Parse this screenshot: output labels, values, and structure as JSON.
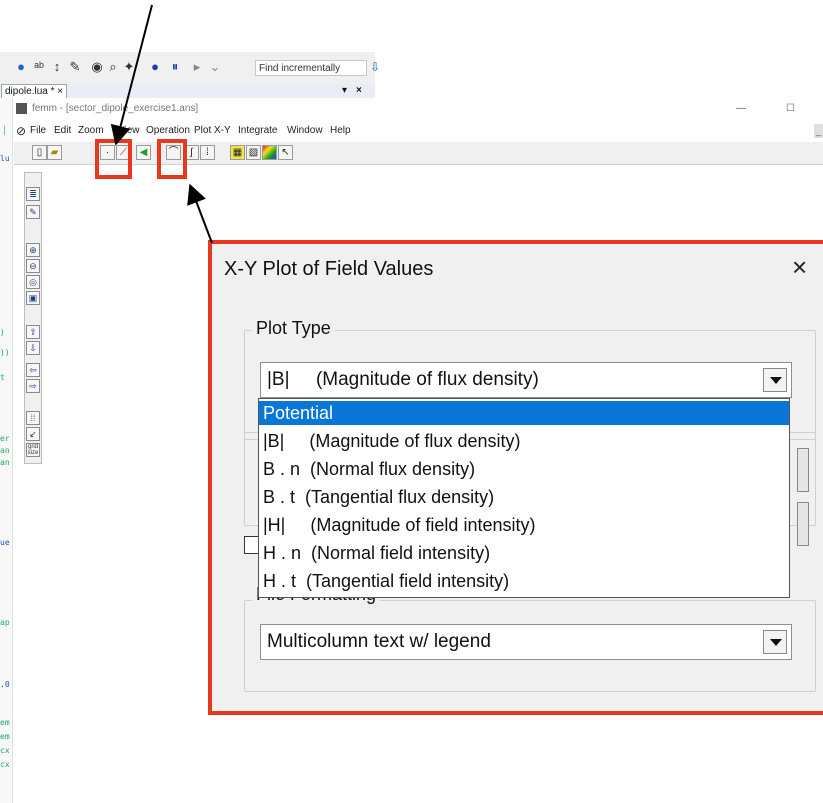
{
  "editor": {
    "find_placeholder": "Find incrementally",
    "tab_label": "dipole.lua *",
    "tab_close": "×"
  },
  "femm": {
    "title": "femm - [sector_dipole_exercise1.ans]",
    "menu": [
      "File",
      "Edit",
      "Zoom",
      "View",
      "Operation",
      "Plot X-Y",
      "Integrate",
      "Window",
      "Help"
    ],
    "min_glyph": "—",
    "max_glyph": "☐"
  },
  "dialog": {
    "title": "X-Y Plot of Field Values",
    "close": "×",
    "plot_type_label": "Plot Type",
    "plot_type_value": "|B|     (Magnitude of flux density)",
    "file_format_label": "File Formatting",
    "file_format_value": "Multicolumn text w/ legend",
    "dropdown_options": [
      "Potential",
      "|B|     (Magnitude of flux density)",
      "B . n  (Normal flux density)",
      "B . t  (Tangential flux density)",
      "|H|     (Magnitude of field intensity)",
      "H . n  (Normal field intensity)",
      "H . t  (Tangential field intensity)"
    ],
    "selected_index": 0
  },
  "colors": {
    "highlight_red": "#e8391e",
    "selection_blue": "#0a76d8"
  }
}
